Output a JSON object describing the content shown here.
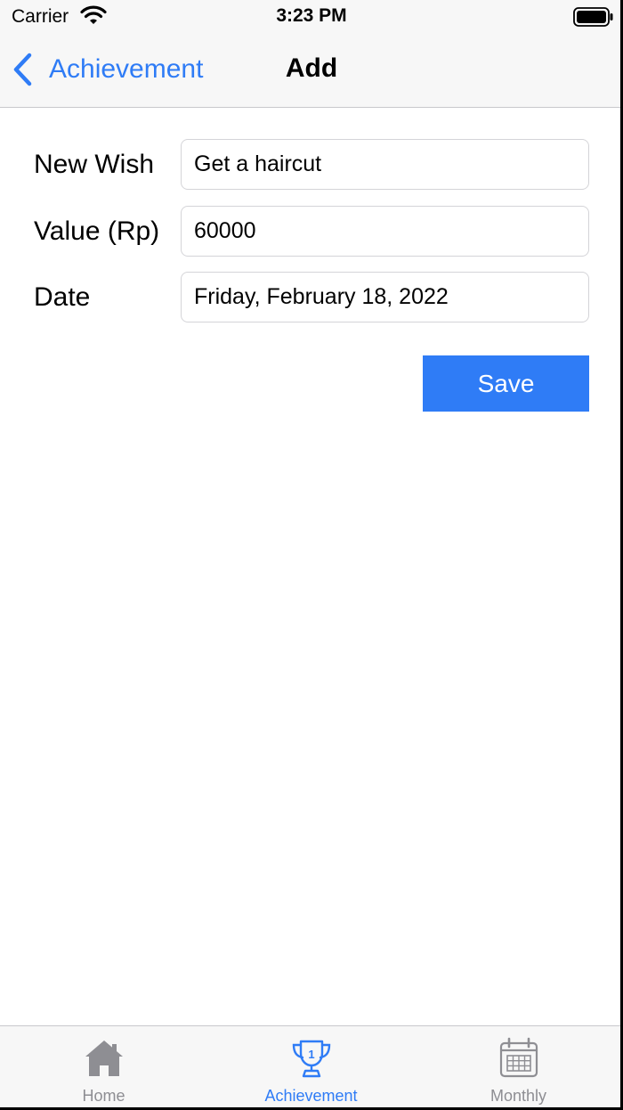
{
  "status_bar": {
    "carrier": "Carrier",
    "time": "3:23 PM",
    "icons": [
      "wifi-icon",
      "battery-icon"
    ]
  },
  "nav_bar": {
    "back_label": "Achievement",
    "title": "Add",
    "back_icon": "chevron-left-icon"
  },
  "form": {
    "wish_label": "New Wish",
    "wish_value": "Get a haircut",
    "value_label": "Value (Rp)",
    "value_value": "60000",
    "date_label": "Date",
    "date_value": "Friday, February 18, 2022",
    "save_label": "Save"
  },
  "tab_bar": {
    "tabs": [
      {
        "label": "Home",
        "icon": "house-icon",
        "active": false
      },
      {
        "label": "Achievement",
        "icon": "trophy-icon",
        "active": true
      },
      {
        "label": "Monthly",
        "icon": "calendar-icon",
        "active": false
      }
    ]
  },
  "colors": {
    "accent": "#2f7cf6",
    "inactive": "#8e8e93",
    "bar_background": "#f7f7f7"
  }
}
